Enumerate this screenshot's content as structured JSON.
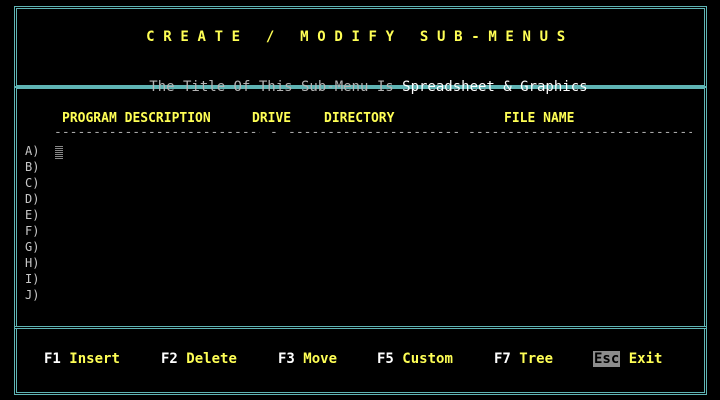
{
  "header": {
    "title": "CREATE / MODIFY SUB-MENUS",
    "subtitle_label": "The Title Of This Sub-Menu Is",
    "subtitle_value": "Spreadsheet & Graphics"
  },
  "columns": [
    {
      "label": "PROGRAM DESCRIPTION"
    },
    {
      "label": "DRIVE"
    },
    {
      "label": "DIRECTORY"
    },
    {
      "label": "FILE NAME"
    }
  ],
  "rows": [
    {
      "label": "A)"
    },
    {
      "label": "B)"
    },
    {
      "label": "C)"
    },
    {
      "label": "D)"
    },
    {
      "label": "E)"
    },
    {
      "label": "F)"
    },
    {
      "label": "G)"
    },
    {
      "label": "H)"
    },
    {
      "label": "I)"
    },
    {
      "label": "J)"
    }
  ],
  "function_keys": [
    {
      "key": "F1",
      "action": "Insert"
    },
    {
      "key": "F2",
      "action": "Delete"
    },
    {
      "key": "F3",
      "action": "Move"
    },
    {
      "key": "F5",
      "action": "Custom"
    },
    {
      "key": "F7",
      "action": "Tree"
    },
    {
      "key": "Esc",
      "action": "Exit"
    }
  ],
  "colors": {
    "border": "#5fb4b4",
    "accent": "#ffff55",
    "background": "#000000"
  }
}
